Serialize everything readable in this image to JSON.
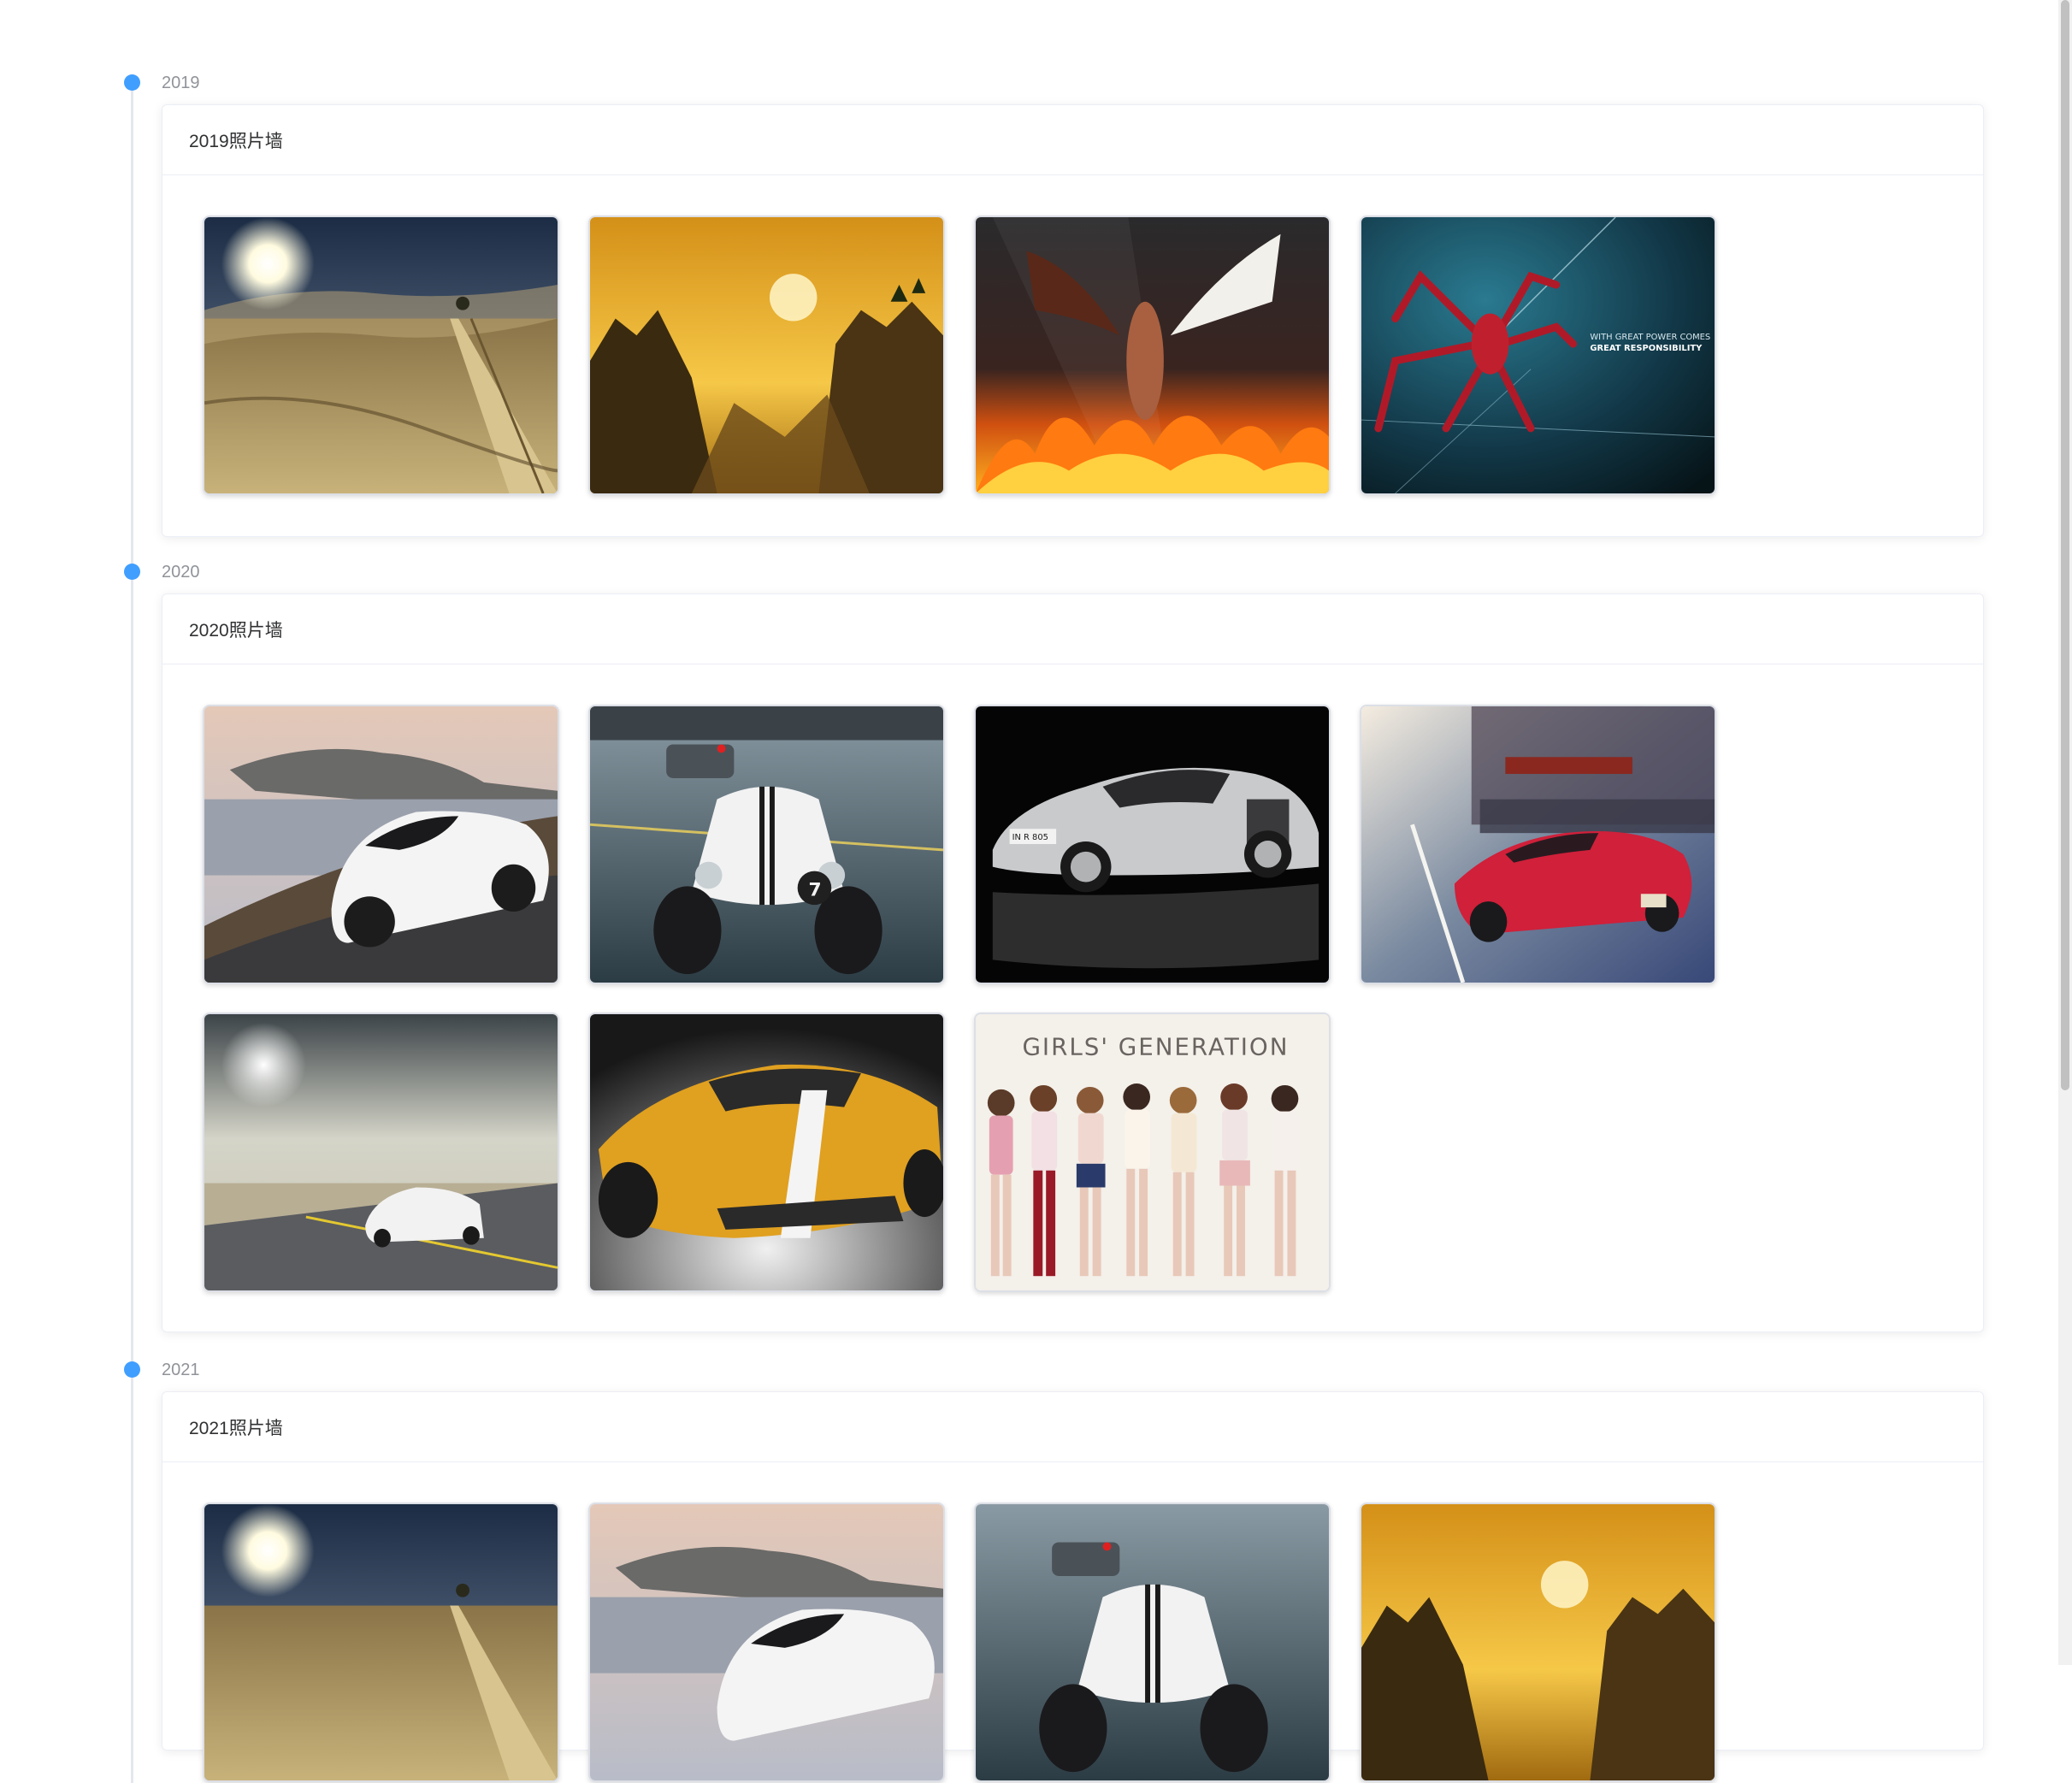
{
  "timeline": [
    {
      "timestamp": "2019",
      "card_title": "2019照片墙",
      "photos": [
        "desert-road-sunburst",
        "golden-mountain-sunset",
        "angel-demon-fire",
        "spider-emblem-great-responsibility"
      ]
    },
    {
      "timestamp": "2020",
      "card_title": "2020照片墙",
      "photos": [
        "white-bugatti-coast",
        "caterham-seven-race",
        "silver-audi-r8",
        "red-ferrari-street",
        "bugatti-desert-highway",
        "orange-lamborghini",
        "girls-generation-group"
      ]
    },
    {
      "timestamp": "2021",
      "card_title": "2021照片墙",
      "photos": [
        "desert-road-sunburst",
        "white-bugatti-coast",
        "caterham-seven-race",
        "golden-mountain-sunset"
      ]
    }
  ],
  "photo_text": {
    "spider_line1": "WITH GREAT POWER COMES",
    "spider_line2": "GREAT RESPONSIBILITY",
    "gg_title": "GIRLS' GENERATION",
    "audi_plate": "IN R 805",
    "caterham_number": "7"
  }
}
